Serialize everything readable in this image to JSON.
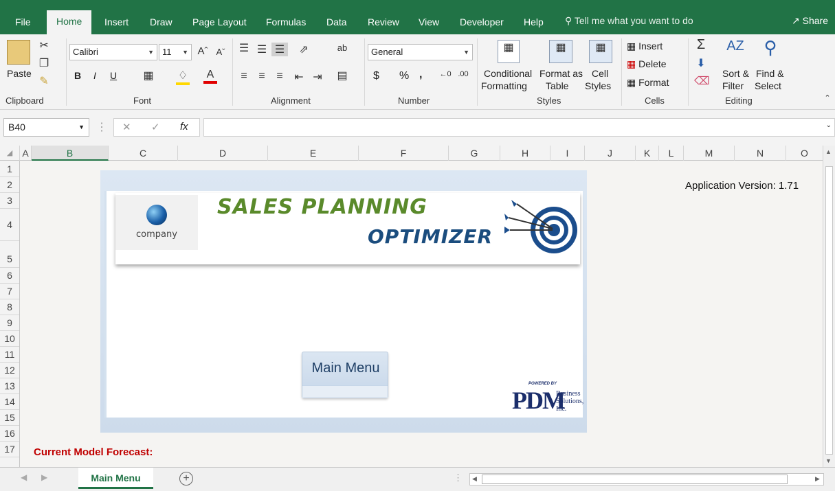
{
  "ribbon_tabs": [
    "File",
    "Home",
    "Insert",
    "Draw",
    "Page Layout",
    "Formulas",
    "Data",
    "Review",
    "View",
    "Developer",
    "Help"
  ],
  "active_tab": "Home",
  "tell_me": "Tell me what you want to do",
  "share": "Share",
  "clipboard": {
    "paste": "Paste",
    "label": "Clipboard"
  },
  "font": {
    "family": "Calibri",
    "size": "11",
    "label": "Font",
    "bold": "B",
    "italic": "I",
    "underline": "U"
  },
  "alignment": {
    "label": "Alignment"
  },
  "number": {
    "format": "General",
    "label": "Number",
    "currency": "$",
    "percent": "%",
    "comma": ","
  },
  "styles": {
    "conditional": "Conditional",
    "conditional2": "Formatting",
    "format_as": "Format as",
    "format_as2": "Table",
    "cell": "Cell",
    "cell2": "Styles",
    "label": "Styles"
  },
  "cells": {
    "insert": "Insert",
    "delete": "Delete",
    "format": "Format",
    "label": "Cells"
  },
  "editing": {
    "sort": "Sort &",
    "sort2": "Filter",
    "find": "Find &",
    "find2": "Select",
    "label": "Editing"
  },
  "formula_bar": {
    "name_box": "B40",
    "fx": "fx",
    "value": ""
  },
  "columns": [
    "A",
    "B",
    "C",
    "D",
    "E",
    "F",
    "G",
    "H",
    "I",
    "J",
    "K",
    "L",
    "M",
    "N",
    "O"
  ],
  "rows": [
    "1",
    "2",
    "3",
    "4",
    "5",
    "6",
    "7",
    "8",
    "9",
    "10",
    "11",
    "12",
    "13",
    "14",
    "15",
    "16",
    "17"
  ],
  "sheet": {
    "app_version": "Application Version: 1.71",
    "banner_logo_text": "company",
    "banner_title_1": "SALES PLANNING",
    "banner_title_2": "OPTIMIZER",
    "main_menu_button": "Main Menu",
    "powered_by": "POWERED BY",
    "pdm": "PDM",
    "pdm_sub": [
      "Business",
      "Solutions,",
      "Inc."
    ],
    "forecast_label": "Current Model Forecast:"
  },
  "sheet_tabs": [
    "Main Menu"
  ],
  "colors": {
    "accent": "#217346",
    "forecast": "#c00000"
  }
}
